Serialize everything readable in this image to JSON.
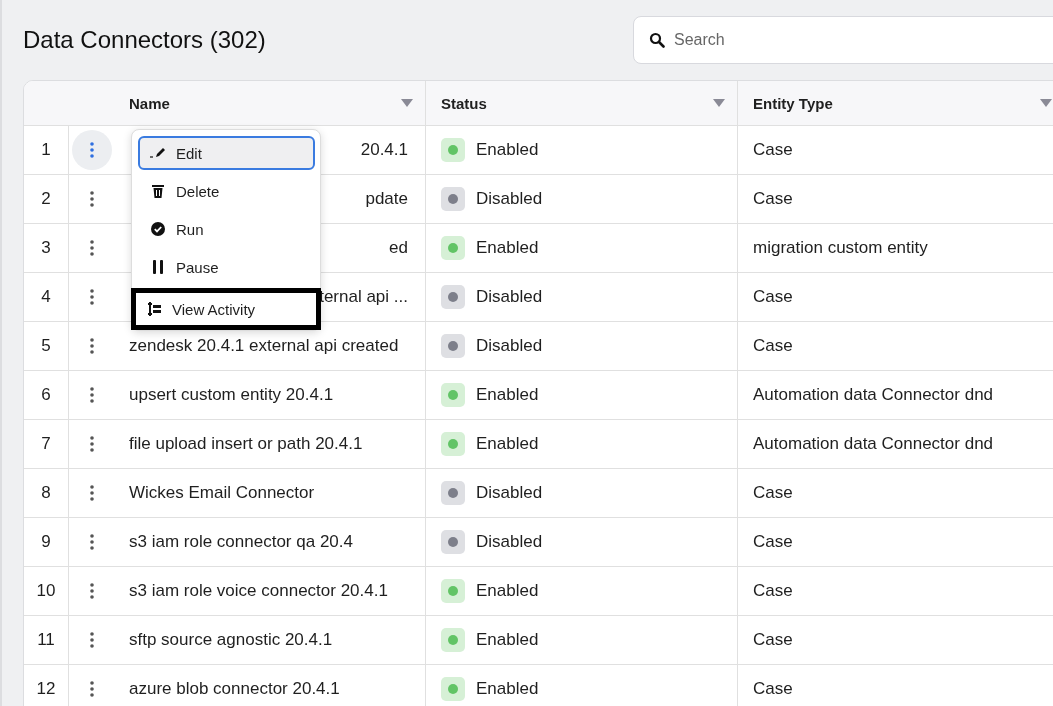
{
  "title": "Data Connectors (302)",
  "search": {
    "placeholder": "Search"
  },
  "table": {
    "columns": [
      "Name",
      "Status",
      "Entity Type"
    ],
    "rows": [
      {
        "index": "1",
        "name": "20.4.1",
        "status": "Enabled",
        "enabled": true,
        "entity_type": "Case",
        "menu_open": true,
        "name_covered": true
      },
      {
        "index": "2",
        "name": "pdate",
        "status": "Disabled",
        "enabled": false,
        "entity_type": "Case",
        "menu_open": false,
        "name_covered": true
      },
      {
        "index": "3",
        "name": "ed",
        "status": "Enabled",
        "enabled": true,
        "entity_type": "migration custom entity",
        "menu_open": false,
        "name_covered": true
      },
      {
        "index": "4",
        "name": "ternal api ...",
        "status": "Disabled",
        "enabled": false,
        "entity_type": "Case",
        "menu_open": false,
        "name_covered": true
      },
      {
        "index": "5",
        "name": "zendesk 20.4.1 external api created",
        "status": "Disabled",
        "enabled": false,
        "entity_type": "Case",
        "menu_open": false,
        "name_covered": false
      },
      {
        "index": "6",
        "name": "upsert custom entity 20.4.1",
        "status": "Enabled",
        "enabled": true,
        "entity_type": "Automation data Connector dnd",
        "menu_open": false,
        "name_covered": false
      },
      {
        "index": "7",
        "name": "file upload insert or path 20.4.1",
        "status": "Enabled",
        "enabled": true,
        "entity_type": "Automation data Connector dnd",
        "menu_open": false,
        "name_covered": false
      },
      {
        "index": "8",
        "name": "Wickes Email Connector",
        "status": "Disabled",
        "enabled": false,
        "entity_type": "Case",
        "menu_open": false,
        "name_covered": false
      },
      {
        "index": "9",
        "name": "s3 iam role connector qa 20.4",
        "status": "Disabled",
        "enabled": false,
        "entity_type": "Case",
        "menu_open": false,
        "name_covered": false
      },
      {
        "index": "10",
        "name": "s3 iam role voice connector 20.4.1",
        "status": "Enabled",
        "enabled": true,
        "entity_type": "Case",
        "menu_open": false,
        "name_covered": false
      },
      {
        "index": "11",
        "name": "sftp source agnostic 20.4.1",
        "status": "Enabled",
        "enabled": true,
        "entity_type": "Case",
        "menu_open": false,
        "name_covered": false
      },
      {
        "index": "12",
        "name": "azure blob connector 20.4.1",
        "status": "Enabled",
        "enabled": true,
        "entity_type": "Case",
        "menu_open": false,
        "name_covered": false
      }
    ]
  },
  "menu": {
    "items": [
      {
        "kind": "edit",
        "label": "Edit",
        "selected": true,
        "outlined": false
      },
      {
        "kind": "delete",
        "label": "Delete",
        "selected": false,
        "outlined": false
      },
      {
        "kind": "run",
        "label": "Run",
        "selected": false,
        "outlined": false
      },
      {
        "kind": "pause",
        "label": "Pause",
        "selected": false,
        "outlined": false
      },
      {
        "kind": "activity",
        "label": "View Activity",
        "selected": false,
        "outlined": true
      }
    ]
  }
}
